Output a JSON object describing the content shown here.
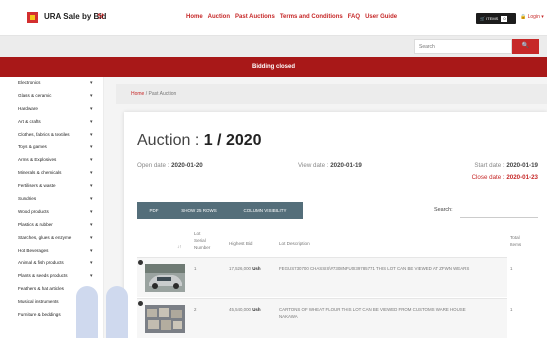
{
  "header": {
    "brand": "URA Sale by Bid",
    "nav": [
      "Home",
      "Auction",
      "Past Auctions",
      "Terms and Conditions",
      "FAQ",
      "User Guide"
    ],
    "cart_label": "ITEMS",
    "cart_count": "0",
    "login_label": "Login"
  },
  "search": {
    "placeholder": "Search",
    "button_icon": "search-icon"
  },
  "banner": "Bidding closed",
  "sidebar": {
    "categories": [
      "Electronics",
      "Glass & ceramic",
      "Hardware",
      "Art & crafts",
      "Clothes, fabrics & textiles",
      "Toys & games",
      "Arms & Explosives",
      "Minerals & chemicals",
      "Fertilisers & waste",
      "Sundries",
      "Wood products",
      "Plastics & rubber",
      "Starches, glues & enzyme",
      "Hot Beverages",
      "Animal & fish products",
      "Plants & seeds products",
      "Feathers & hat articles",
      "Musical instruments",
      "Furniture & beddings"
    ]
  },
  "breadcrumb": {
    "home": "Home",
    "sep": "/",
    "current": "Past Auction"
  },
  "auction": {
    "title_prefix": "Auction : ",
    "title_number": "1 / 2020",
    "open_label": "Open date : ",
    "open_date": "2020-01-20",
    "view_label": "View date : ",
    "view_date": "2020-01-19",
    "start_label": "Start date : ",
    "start_date": "2020-01-19",
    "close_label": "Close date : ",
    "close_date": "2020-01-23"
  },
  "table": {
    "buttons": [
      "PDF",
      "SHOW 25 ROWS",
      "COLUMN VISIBILITY"
    ],
    "search_label": "Search:",
    "sort_indicator": "↓↑",
    "headers": {
      "serial": [
        "Lot",
        "Serial",
        "Number"
      ],
      "bid": "Highest Bid",
      "desc": "Lot Description",
      "items": [
        "Total",
        "Items"
      ]
    },
    "rows": [
      {
        "serial": "1",
        "bid_amount": "17,526,000",
        "bid_currency": "Ush",
        "description": "FEGUS730700 CHASSIS\\#7308NFU0I39785771 THIS LOT CAN BE VIEWED AT ZFWN WEARS",
        "items": "1"
      },
      {
        "serial": "2",
        "bid_amount": "45,540,000",
        "bid_currency": "Ush",
        "description_line1": "CARTONS OF WHEAT FLOUR THIS LOT CAN BE VIEWED FROM CUSTOMS WARE HOUSE",
        "description_line2": "NAKAWA",
        "items": "1"
      }
    ]
  },
  "colors": {
    "accent": "#c62828",
    "banner": "#a81818",
    "buttons": "#546e7a"
  }
}
